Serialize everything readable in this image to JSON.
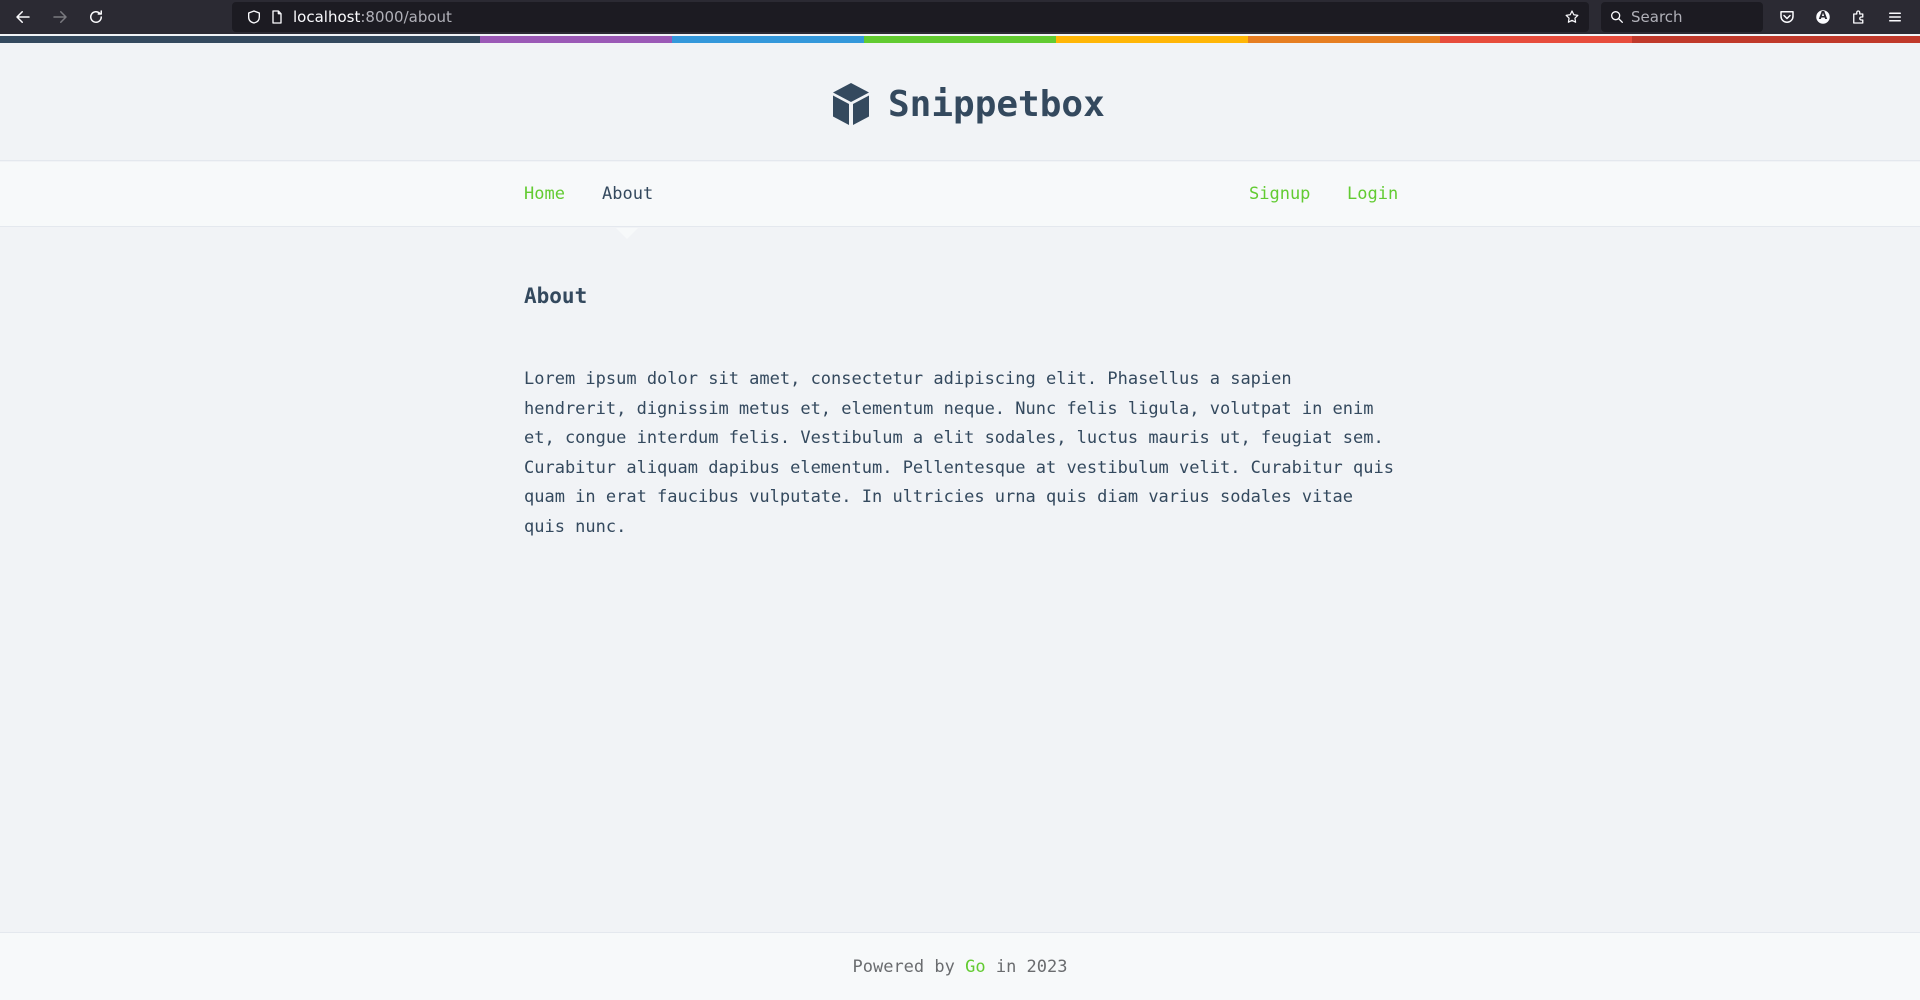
{
  "browser": {
    "url_host": "localhost",
    "url_path": ":8000/about",
    "search_placeholder": "Search",
    "profile_initial": "A"
  },
  "stripe_colors": [
    "#34495e",
    "#9b59b6",
    "#3498db",
    "#62cb31",
    "#ffb606",
    "#e67e22",
    "#e74c3c",
    "#c0392b"
  ],
  "header": {
    "title": "Snippetbox",
    "logo_icon": "cube-icon"
  },
  "nav": {
    "left": [
      {
        "label": "Home",
        "active": false
      },
      {
        "label": "About",
        "active": true
      }
    ],
    "right": [
      {
        "label": "Signup"
      },
      {
        "label": "Login"
      }
    ]
  },
  "main": {
    "title": "About",
    "body": "Lorem ipsum dolor sit amet, consectetur adipiscing elit. Phasellus a sapien hendrerit, dignissim metus et, elementum neque. Nunc felis ligula, volutpat in enim et, congue interdum felis. Vestibulum a elit sodales, luctus mauris ut, feugiat sem. Curabitur aliquam dapibus elementum. Pellentesque at vestibulum velit. Curabitur quis quam in erat faucibus vulputate. In ultricies urna quis diam varius sodales vitae quis nunc."
  },
  "footer": {
    "prefix": "Powered by",
    "link": "Go",
    "suffix": "in 2023"
  },
  "colors": {
    "accent": "#62cb31",
    "text": "#34495e"
  }
}
